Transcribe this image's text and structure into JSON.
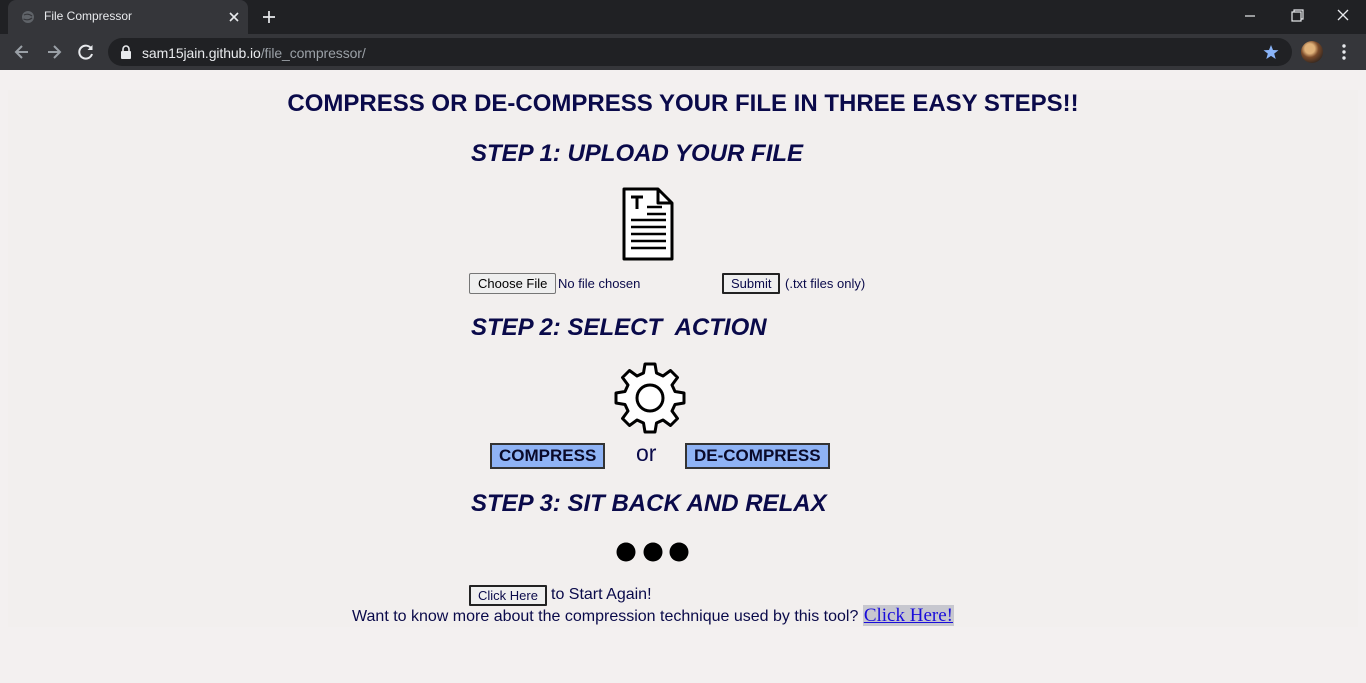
{
  "browser": {
    "tab_title": "File Compressor",
    "url_host": "sam15jain.github.io",
    "url_path": "/file_compressor/"
  },
  "page": {
    "headline": "COMPRESS OR DE-COMPRESS YOUR FILE IN THREE EASY STEPS!!",
    "step1_title": "STEP 1: UPLOAD YOUR FILE",
    "choose_file_label": "Choose File",
    "file_status": "No file chosen",
    "submit_label": "Submit",
    "file_hint": "(.txt files only)",
    "step2_title": "STEP 2: SELECT  ACTION",
    "compress_label": "COMPRESS",
    "or_text": "or",
    "decompress_label": "DE-COMPRESS",
    "step3_title": "STEP 3: SIT BACK AND RELAX",
    "again_button_label": "Click Here",
    "again_text": "to Start Again!",
    "info_text": "Want to know more about the compression technique used by this tool?",
    "info_link": "Click Here!"
  },
  "icons": {
    "upload": "document-icon",
    "action": "gear-icon",
    "relax": "loading-dots-icon"
  },
  "colors": {
    "heading": "#0a0a4a",
    "action_button": "#8fb3f5",
    "page_background": "#f2efee",
    "link": "#1a0ddb"
  }
}
